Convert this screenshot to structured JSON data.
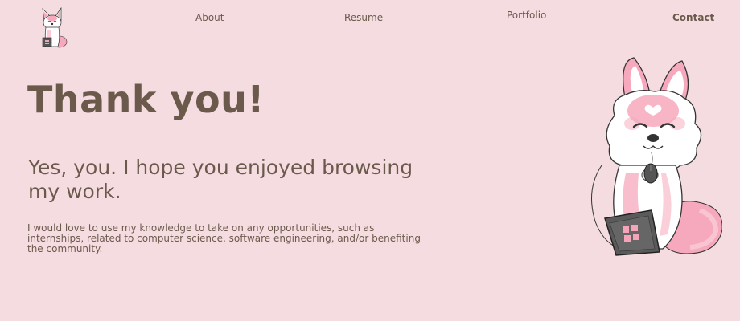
{
  "nav": {
    "about": "About",
    "resume": "Resume",
    "portfolio": "Portfolio",
    "contact": "Contact",
    "active": "contact"
  },
  "logo": {
    "icon": "fox-mascot-icon"
  },
  "content": {
    "heading": "Thank you!",
    "subheading": "Yes, you. I hope you enjoyed browsing my work.",
    "body": "I would love to use my knowledge to take on any opportunities, such as internships, related to computer science, software engineering, and/or benefiting the community."
  },
  "illustration": {
    "icon": "fox-with-laptop-illustration"
  },
  "colors": {
    "background": "#f5dce0",
    "text": "#6b5a4c",
    "pink": "#f4a3b8",
    "laptop": "#555555"
  }
}
